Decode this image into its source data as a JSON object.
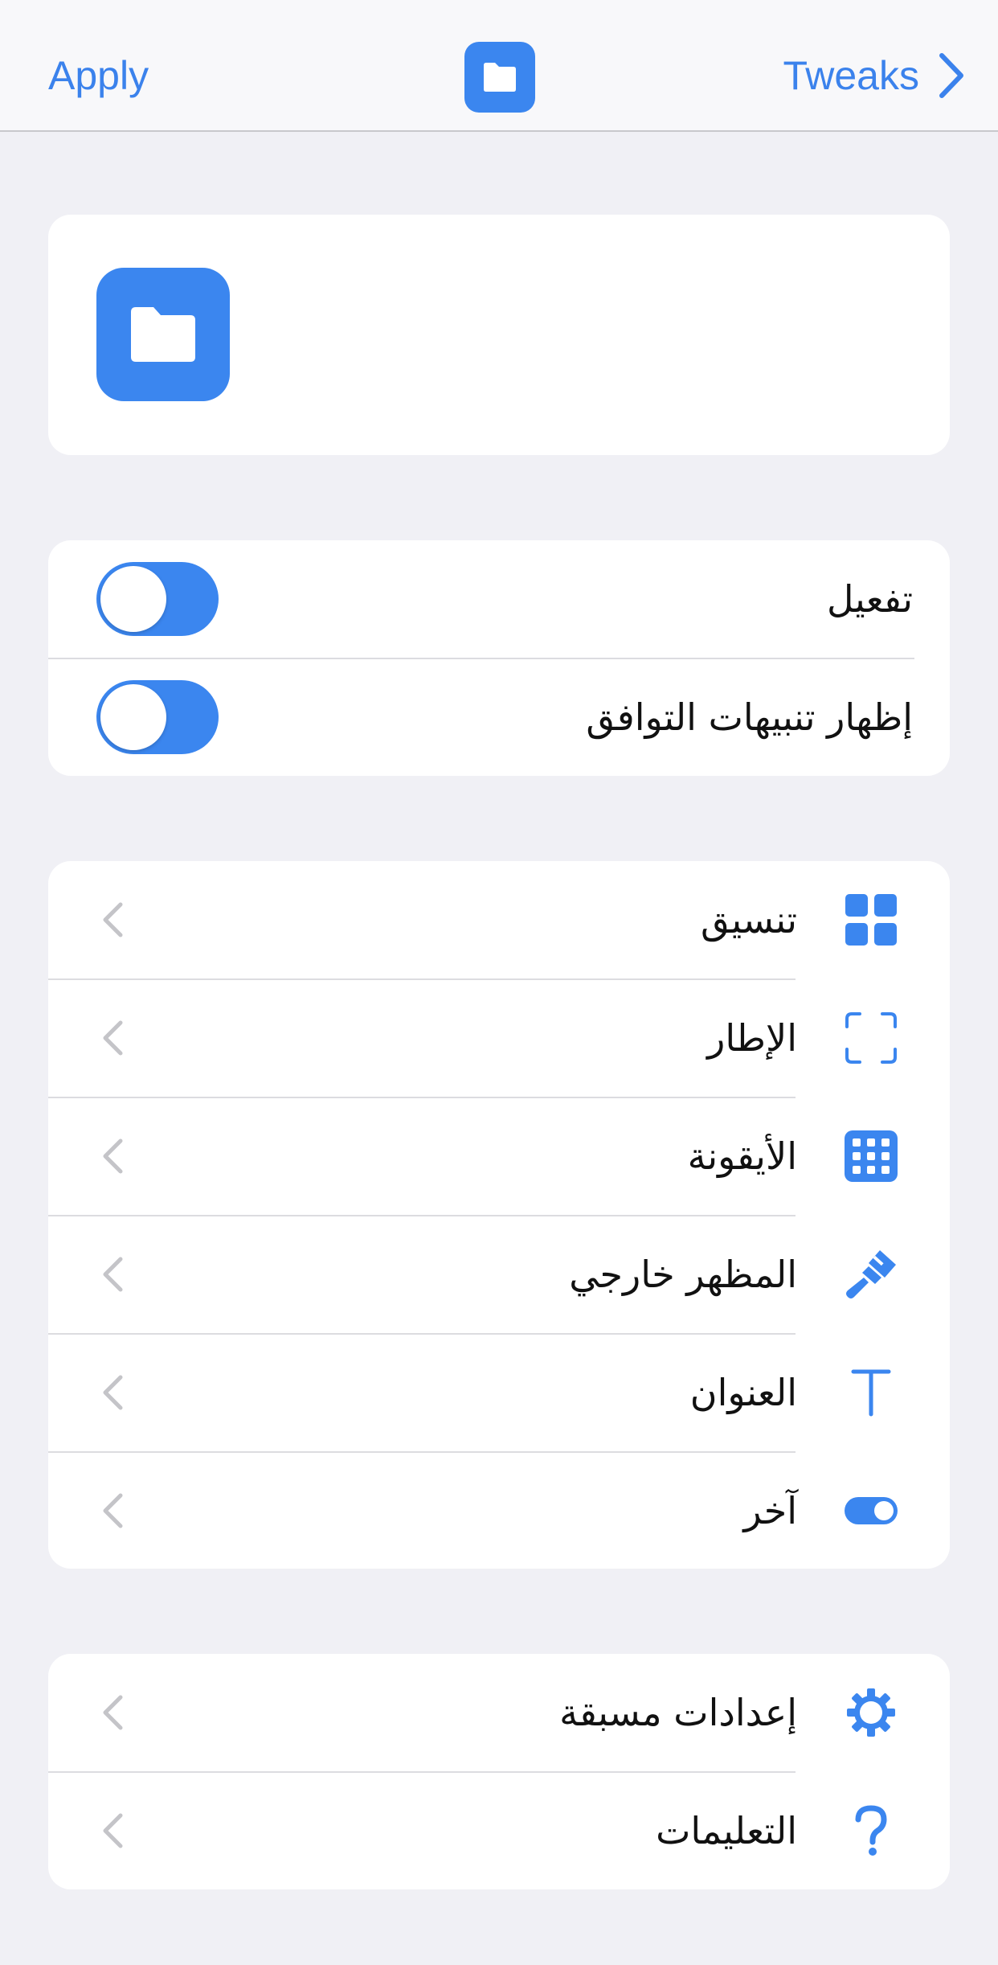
{
  "navbar": {
    "apply_label": "Apply",
    "center_icon": "folder-icon",
    "tweaks_label": "Tweaks",
    "tweaks_icon": "chevron-right-icon"
  },
  "preview": {
    "icon": "folder-icon"
  },
  "toggles": [
    {
      "label": "تفعيل",
      "state": "on"
    },
    {
      "label": "إظهار تنبيهات التوافق",
      "state": "on"
    }
  ],
  "menu": [
    {
      "label": "تنسيق",
      "icon": "grid-four-icon"
    },
    {
      "label": "الإطار",
      "icon": "frame-corners-icon"
    },
    {
      "label": "الأيقونة",
      "icon": "icon-grid-icon"
    },
    {
      "label": "المظهر خارجي",
      "icon": "paintbrush-icon"
    },
    {
      "label": "العنوان",
      "icon": "text-t-icon"
    },
    {
      "label": "آخر",
      "icon": "switch-icon"
    }
  ],
  "menu2": [
    {
      "label": "إعدادات مسبقة",
      "icon": "gear-icon"
    },
    {
      "label": "التعليمات",
      "icon": "question-icon"
    }
  ],
  "colors": {
    "accent": "#3b86ef",
    "background": "#f0f0f5",
    "card": "#ffffff"
  }
}
